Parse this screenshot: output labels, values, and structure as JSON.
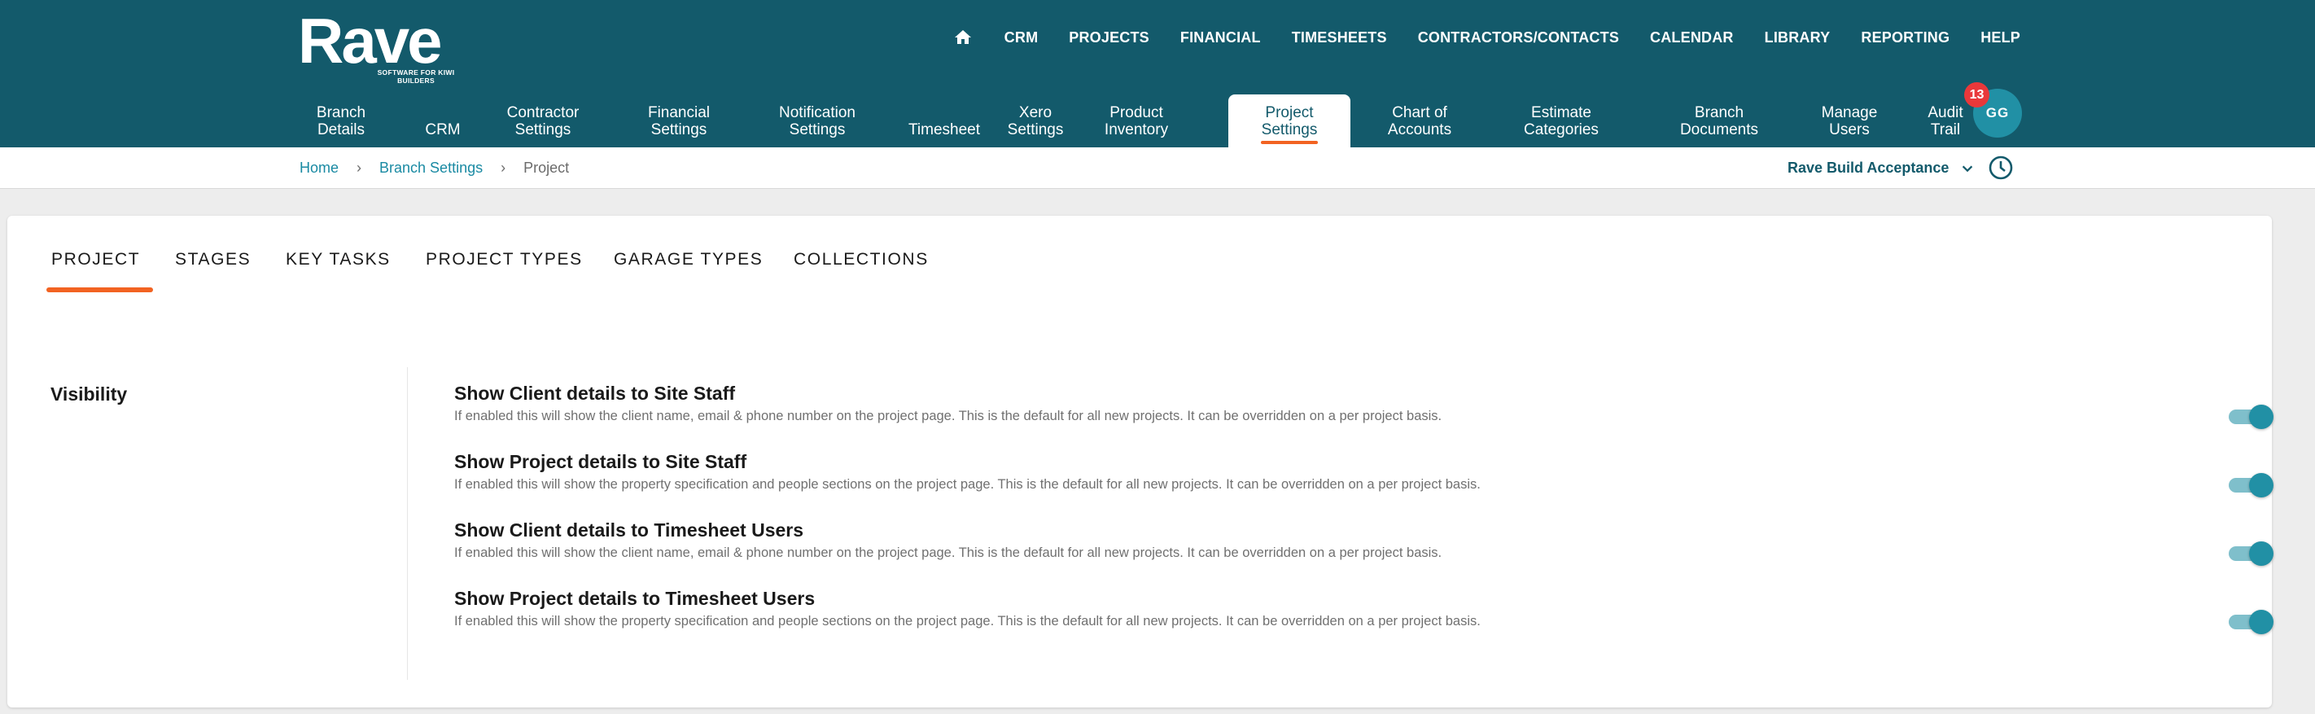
{
  "app": {
    "logo_text": "Rave",
    "logo_tagline": "SOFTWARE FOR KIWI BUILDERS"
  },
  "topnav": {
    "home_icon": "home-icon",
    "items": [
      "CRM",
      "PROJECTS",
      "FINANCIAL",
      "TIMESHEETS",
      "CONTRACTORS/CONTACTS",
      "CALENDAR",
      "LIBRARY",
      "REPORTING",
      "HELP"
    ]
  },
  "subnav": {
    "items": [
      {
        "label": "Branch\nDetails"
      },
      {
        "label": "CRM"
      },
      {
        "label": "Contractor\nSettings"
      },
      {
        "label": "Financial\nSettings"
      },
      {
        "label": "Notification\nSettings"
      },
      {
        "label": "Timesheet"
      },
      {
        "label": "Xero\nSettings"
      },
      {
        "label": "Product\nInventory"
      },
      {
        "label": "Project\nSettings"
      },
      {
        "label": "Chart of\nAccounts"
      },
      {
        "label": "Estimate\nCategories"
      },
      {
        "label": "Branch\nDocuments"
      },
      {
        "label": "Manage\nUsers"
      },
      {
        "label": "Audit\nTrail"
      }
    ],
    "active": "Project Settings"
  },
  "user": {
    "initials": "GG",
    "notification_count": "13"
  },
  "breadcrumb": {
    "home": "Home",
    "parent": "Branch Settings",
    "current": "Project"
  },
  "branch_selector": {
    "value": "Rave Build Acceptance"
  },
  "tabs": {
    "items": [
      "PROJECT",
      "STAGES",
      "KEY TASKS",
      "PROJECT TYPES",
      "GARAGE TYPES",
      "COLLECTIONS"
    ],
    "active": "PROJECT"
  },
  "visibility": {
    "title": "Visibility",
    "settings": [
      {
        "title": "Show Client details to Site Staff",
        "description": "If enabled this will show the client name, email & phone number on the project page. This is the default for all new projects. It can be overridden on a per project basis.",
        "enabled": true
      },
      {
        "title": "Show Project details to Site Staff",
        "description": "If enabled this will show the property specification and people sections on the project page. This is the default for all new projects. It can be overridden on a per project basis.",
        "enabled": true
      },
      {
        "title": "Show Client details to Timesheet Users",
        "description": "If enabled this will show the client name, email & phone number on the project page. This is the default for all new projects. It can be overridden on a per project basis.",
        "enabled": true
      },
      {
        "title": "Show Project details to Timesheet Users",
        "description": "If enabled this will show the property specification and people sections on the project page. This is the default for all new projects. It can be overridden on a per project basis.",
        "enabled": true
      }
    ]
  },
  "colors": {
    "header_bg": "#135a6b",
    "accent": "#f26322",
    "link": "#1a8aa3",
    "toggle_on": "#2190a5",
    "badge": "#e9383a"
  }
}
